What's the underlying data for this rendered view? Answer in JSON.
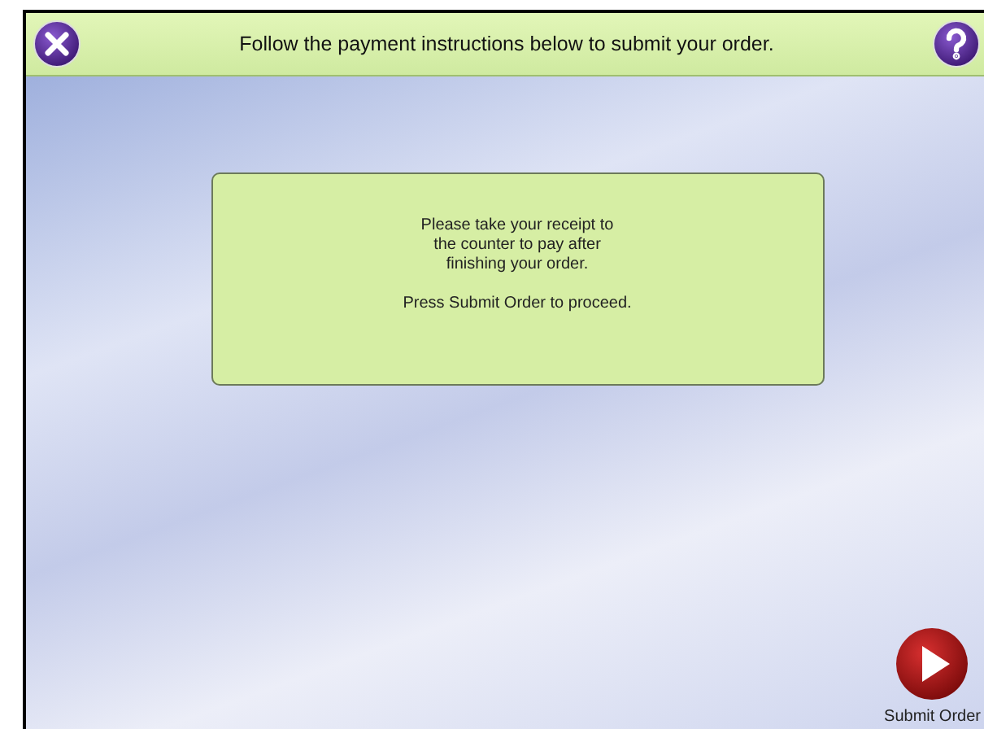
{
  "header": {
    "title": "Follow the payment instructions below to submit your order."
  },
  "message": {
    "lines": [
      "Please take your receipt to",
      "the counter to pay after",
      "finishing your order."
    ],
    "note": "Press Submit Order to proceed."
  },
  "submit": {
    "label": "Submit Order"
  }
}
